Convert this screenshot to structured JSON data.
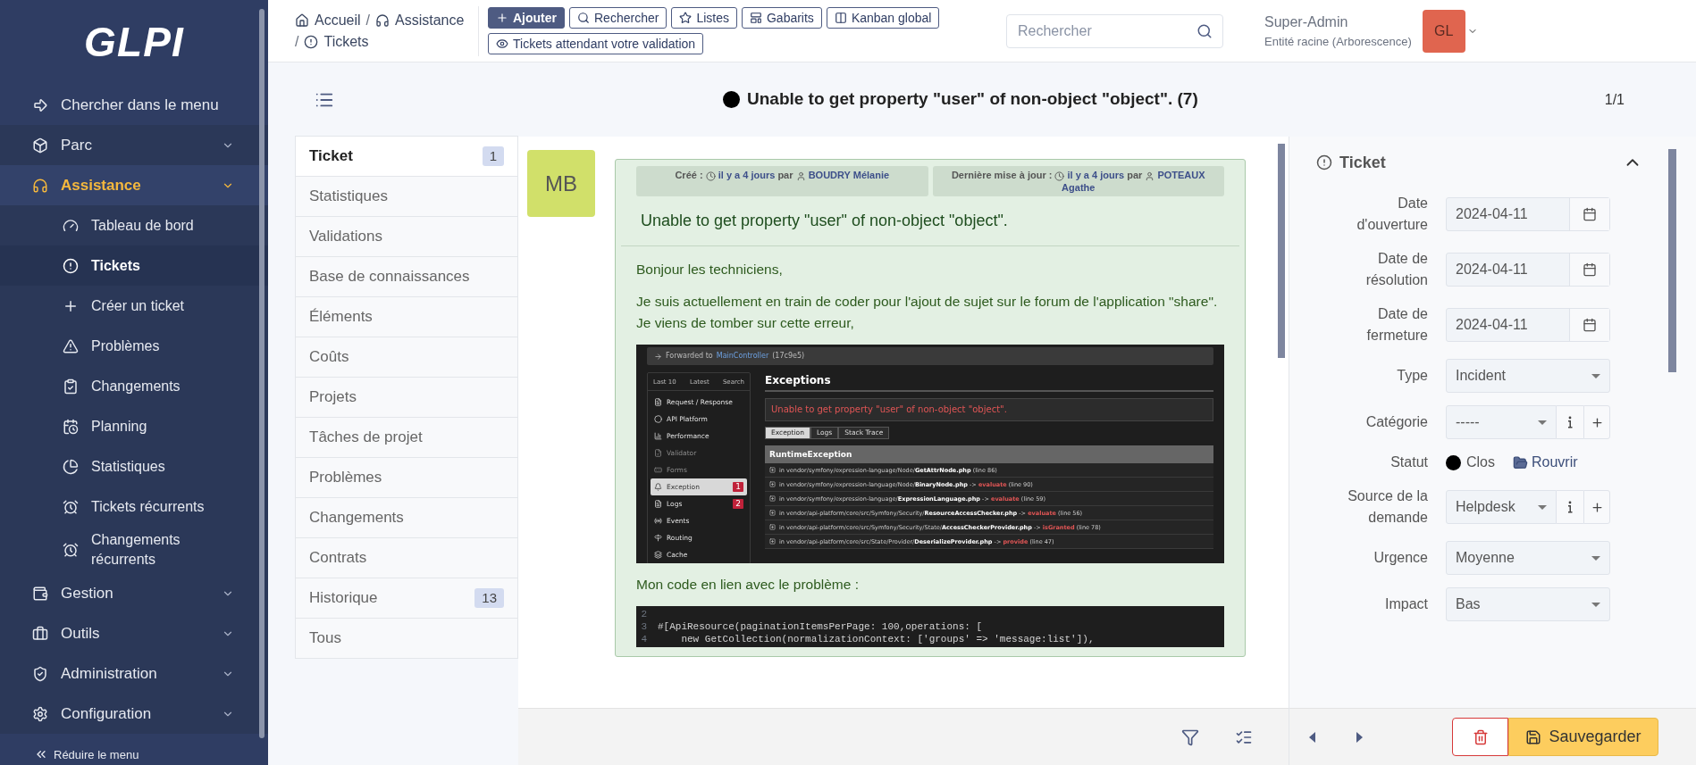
{
  "sidebar": {
    "logo": "GLPI",
    "items": [
      {
        "label": "Chercher dans le menu",
        "kind": "search"
      },
      {
        "label": "Parc",
        "kind": "group",
        "expanded": false,
        "selected": false
      },
      {
        "label": "Assistance",
        "kind": "group",
        "expanded": true,
        "selected": true,
        "children": [
          {
            "label": "Tableau de bord",
            "selected": false
          },
          {
            "label": "Tickets",
            "selected": true
          },
          {
            "label": "Créer un ticket",
            "selected": false
          },
          {
            "label": "Problèmes",
            "selected": false
          },
          {
            "label": "Changements",
            "selected": false
          },
          {
            "label": "Planning",
            "selected": false
          },
          {
            "label": "Statistiques",
            "selected": false
          },
          {
            "label": "Tickets récurrents",
            "selected": false
          },
          {
            "label": "Changements récurrents",
            "selected": false
          }
        ]
      },
      {
        "label": "Gestion",
        "kind": "group",
        "expanded": false,
        "selected": false
      },
      {
        "label": "Outils",
        "kind": "group",
        "expanded": false,
        "selected": false
      },
      {
        "label": "Administration",
        "kind": "group",
        "expanded": false,
        "selected": false
      },
      {
        "label": "Configuration",
        "kind": "group",
        "expanded": false,
        "selected": false
      }
    ],
    "collapse": "Réduire le menu"
  },
  "topbar": {
    "breadcrumbs": [
      {
        "label": "Accueil"
      },
      {
        "separator": "/",
        "label": "Assistance"
      },
      {
        "separator": "/",
        "label": "Tickets"
      }
    ],
    "actions": [
      {
        "label": "Ajouter",
        "kind": "primary"
      },
      {
        "label": "Rechercher",
        "kind": "outline"
      },
      {
        "label": "Listes",
        "kind": "outline"
      },
      {
        "label": "Gabarits",
        "kind": "outline"
      },
      {
        "label": "Kanban global",
        "kind": "outline"
      },
      {
        "label": "Tickets attendant votre validation",
        "kind": "outline"
      }
    ],
    "search": {
      "placeholder": "Rechercher"
    },
    "user": {
      "name": "Super-Admin",
      "entity": "Entité racine (Arborescence)",
      "initials": "GL"
    }
  },
  "header": {
    "title": "Unable to get property \"user\" of non-object \"object\". (7)",
    "counter": "1/1"
  },
  "tabs": [
    {
      "label": "Ticket",
      "badge": "1",
      "selected": true
    },
    {
      "label": "Statistiques",
      "selected": false
    },
    {
      "label": "Validations",
      "selected": false
    },
    {
      "label": "Base de connaissances",
      "selected": false
    },
    {
      "label": "Éléments",
      "selected": false
    },
    {
      "label": "Coûts",
      "selected": false
    },
    {
      "label": "Projets",
      "selected": false
    },
    {
      "label": "Tâches de projet",
      "selected": false
    },
    {
      "label": "Problèmes",
      "selected": false
    },
    {
      "label": "Changements",
      "selected": false
    },
    {
      "label": "Contrats",
      "selected": false
    },
    {
      "label": "Historique",
      "badge": "13",
      "selected": false
    },
    {
      "label": "Tous",
      "selected": false
    }
  ],
  "followup": {
    "initials": "MB",
    "created_label": "Créé :",
    "created_time": "il y a 4 jours",
    "created_by_word": "par",
    "created_by": "BOUDRY Mélanie",
    "updated_label": "Dernière mise à jour :",
    "updated_time": "il y a 4 jours",
    "updated_by_word": "par",
    "updated_by": "POTEAUX Agathe",
    "title": "Unable to get property \"user\" of non-object \"object\".",
    "body": [
      {
        "kind": "text",
        "text": "Bonjour les techniciens,"
      },
      {
        "kind": "text",
        "text": "Je suis actuellement en train de coder pour l'ajout de sujet sur le forum de l'application \"share\". Je viens de tomber sur cette erreur,"
      },
      {
        "kind": "screenshot",
        "forwarded": "Forwarded to",
        "controller": "MainController",
        "hash": "(17c9e5)",
        "nav_tabs": [
          "Last 10",
          "Latest",
          "Search"
        ],
        "nav": [
          {
            "label": "Request / Response",
            "disabled": false,
            "selected": false
          },
          {
            "label": "API Platform",
            "disabled": false,
            "selected": false
          },
          {
            "label": "Performance",
            "disabled": false,
            "selected": false
          },
          {
            "label": "Validator",
            "disabled": true,
            "selected": false
          },
          {
            "label": "Forms",
            "disabled": true,
            "selected": false
          },
          {
            "label": "Exception",
            "badge": "1",
            "disabled": false,
            "selected": true
          },
          {
            "label": "Logs",
            "badge": "2",
            "disabled": false,
            "selected": false
          },
          {
            "label": "Events",
            "disabled": false,
            "selected": false
          },
          {
            "label": "Routing",
            "disabled": false,
            "selected": false
          },
          {
            "label": "Cache",
            "disabled": false,
            "selected": false
          }
        ],
        "heading": "Exceptions",
        "message": "Unable to get property \"user\" of non-object \"object\".",
        "tabs": [
          {
            "label": "Exception",
            "selected": true
          },
          {
            "label": "Logs",
            "selected": false
          },
          {
            "label": "Stack Trace",
            "selected": false
          }
        ],
        "exception": "RuntimeException",
        "trace": [
          {
            "path": "in vendor/symfony/expression-language/Node/",
            "file": "GetAttrNode.php",
            "line": "(line 86)"
          },
          {
            "path": "in vendor/symfony/expression-language/Node/",
            "file": "BinaryNode.php",
            "arrow": "->",
            "method": "evaluate",
            "line": "(line 90)"
          },
          {
            "path": "in vendor/symfony/expression-language/",
            "file": "ExpressionLanguage.php",
            "arrow": "->",
            "method": "evaluate",
            "line": "(line 59)"
          },
          {
            "path": "in vendor/api-platform/core/src/Symfony/Security/",
            "file": "ResourceAccessChecker.php",
            "arrow": "->",
            "method": "evaluate",
            "line": "(line 56)"
          },
          {
            "path": "in vendor/api-platform/core/src/Symfony/Security/State/",
            "file": "AccessCheckerProvider.php",
            "arrow": "->",
            "method": "isGranted",
            "line": "(line 78)"
          },
          {
            "path": "in vendor/api-platform/core/src/State/Provider/",
            "file": "DeserializeProvider.php",
            "arrow": "->",
            "method": "provide",
            "line": "(line 47)"
          }
        ]
      },
      {
        "kind": "text",
        "text": "Mon code en lien avec le problème :"
      },
      {
        "kind": "code",
        "lines": [
          {
            "number": "2"
          },
          {
            "number": "3",
            "code": "#[ApiResource(paginationItemsPerPage: 100,operations: ["
          },
          {
            "number": "4",
            "code": "    new GetCollection(normalizationContext: ['groups' => 'message:list']),"
          }
        ]
      }
    ]
  },
  "panel": {
    "title": "Ticket",
    "fields": [
      {
        "label": "Date d'ouverture",
        "kind": "date",
        "value": "2024-04-11"
      },
      {
        "label": "Date de résolution",
        "kind": "date",
        "value": "2024-04-11"
      },
      {
        "label": "Date de fermeture",
        "kind": "date",
        "value": "2024-04-11"
      },
      {
        "label": "Type",
        "kind": "select",
        "value": "Incident"
      },
      {
        "label": "Catégorie",
        "kind": "select_actions",
        "value": "-----"
      },
      {
        "label": "Statut",
        "kind": "status",
        "value": "Clos",
        "action": "Rouvrir"
      },
      {
        "label": "Source de la demande",
        "kind": "select_actions",
        "value": "Helpdesk"
      },
      {
        "label": "Urgence",
        "kind": "select",
        "value": "Moyenne"
      },
      {
        "label": "Impact",
        "kind": "select",
        "value": "Bas"
      }
    ],
    "save": "Sauvegarder"
  }
}
